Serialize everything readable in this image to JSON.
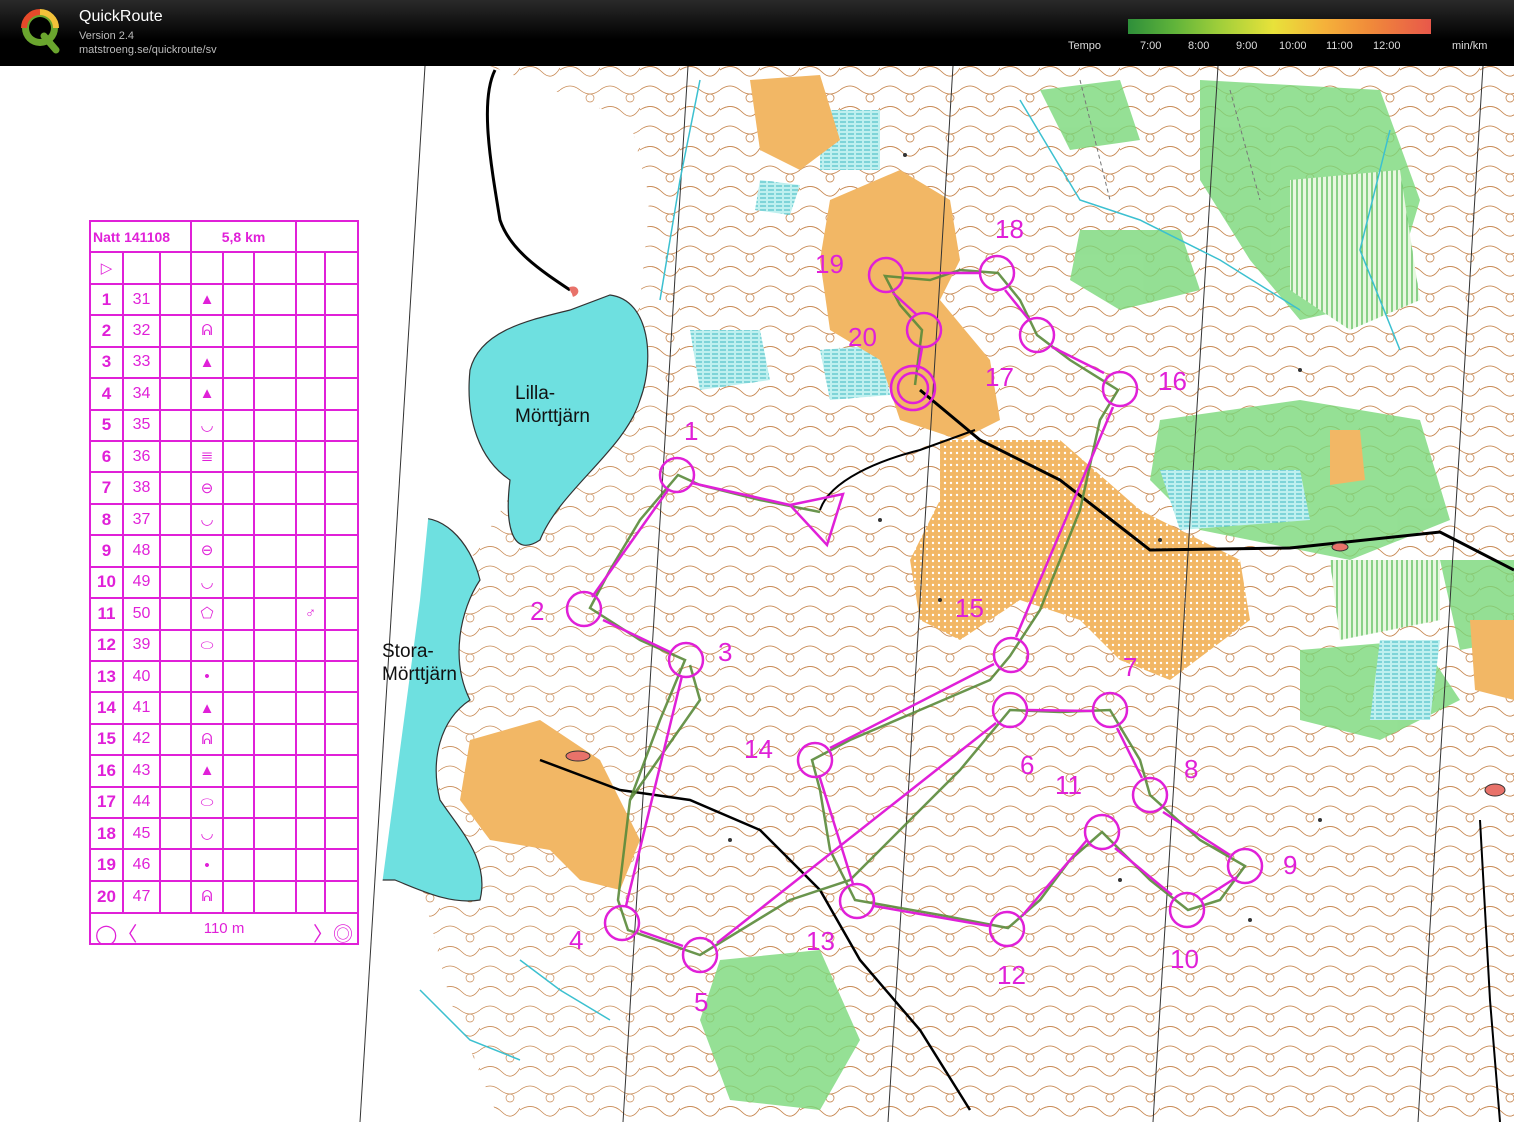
{
  "header": {
    "app_name": "QuickRoute",
    "version": "Version 2.4",
    "url": "matstroeng.se/quickroute/sv",
    "tempo_label": "Tempo",
    "tempo_ticks": [
      "7:00",
      "8:00",
      "9:00",
      "10:00",
      "11:00",
      "12:00"
    ],
    "tempo_unit": "min/km"
  },
  "control_description": {
    "event": "Natt 141108",
    "length": "5,8 km",
    "start_symbol": "▷",
    "rows": [
      {
        "num": "1",
        "code": "31",
        "symbol": "▲"
      },
      {
        "num": "2",
        "code": "32",
        "symbol": "ᕱ"
      },
      {
        "num": "3",
        "code": "33",
        "symbol": "▲"
      },
      {
        "num": "4",
        "code": "34",
        "symbol": "▲"
      },
      {
        "num": "5",
        "code": "35",
        "symbol": "◡"
      },
      {
        "num": "6",
        "code": "36",
        "symbol": "≣"
      },
      {
        "num": "7",
        "code": "38",
        "symbol": "⊖"
      },
      {
        "num": "8",
        "code": "37",
        "symbol": "◡"
      },
      {
        "num": "9",
        "code": "48",
        "symbol": "⊖"
      },
      {
        "num": "10",
        "code": "49",
        "symbol": "◡"
      },
      {
        "num": "11",
        "code": "50",
        "symbol": "⬠",
        "extra": "♂"
      },
      {
        "num": "12",
        "code": "39",
        "symbol": "⬭"
      },
      {
        "num": "13",
        "code": "40",
        "symbol": "•"
      },
      {
        "num": "14",
        "code": "41",
        "symbol": "▲"
      },
      {
        "num": "15",
        "code": "42",
        "symbol": "ᕱ"
      },
      {
        "num": "16",
        "code": "43",
        "symbol": "▲"
      },
      {
        "num": "17",
        "code": "44",
        "symbol": "⬭"
      },
      {
        "num": "18",
        "code": "45",
        "symbol": "◡"
      },
      {
        "num": "19",
        "code": "46",
        "symbol": "•"
      },
      {
        "num": "20",
        "code": "47",
        "symbol": "ᕱ"
      }
    ],
    "finish_distance": "110 m"
  },
  "map": {
    "lakes": [
      {
        "name_line1": "Lilla-",
        "name_line2": "Mörttjärn"
      },
      {
        "name_line1": "Stora-",
        "name_line2": "Mörttjärn"
      }
    ],
    "controls": [
      {
        "label": "1"
      },
      {
        "label": "2"
      },
      {
        "label": "3"
      },
      {
        "label": "4"
      },
      {
        "label": "5"
      },
      {
        "label": "6"
      },
      {
        "label": "7"
      },
      {
        "label": "8"
      },
      {
        "label": "9"
      },
      {
        "label": "10"
      },
      {
        "label": "11"
      },
      {
        "label": "12"
      },
      {
        "label": "13"
      },
      {
        "label": "14"
      },
      {
        "label": "15"
      },
      {
        "label": "16"
      },
      {
        "label": "17"
      },
      {
        "label": "18"
      },
      {
        "label": "19"
      },
      {
        "label": "20"
      }
    ],
    "colors": {
      "course": "#e020d8",
      "water": "#6ee0e0",
      "open": "#f2b765",
      "vegetation": "#6fd06f",
      "contour": "#b0652a",
      "route": "#5a8a3a"
    }
  }
}
